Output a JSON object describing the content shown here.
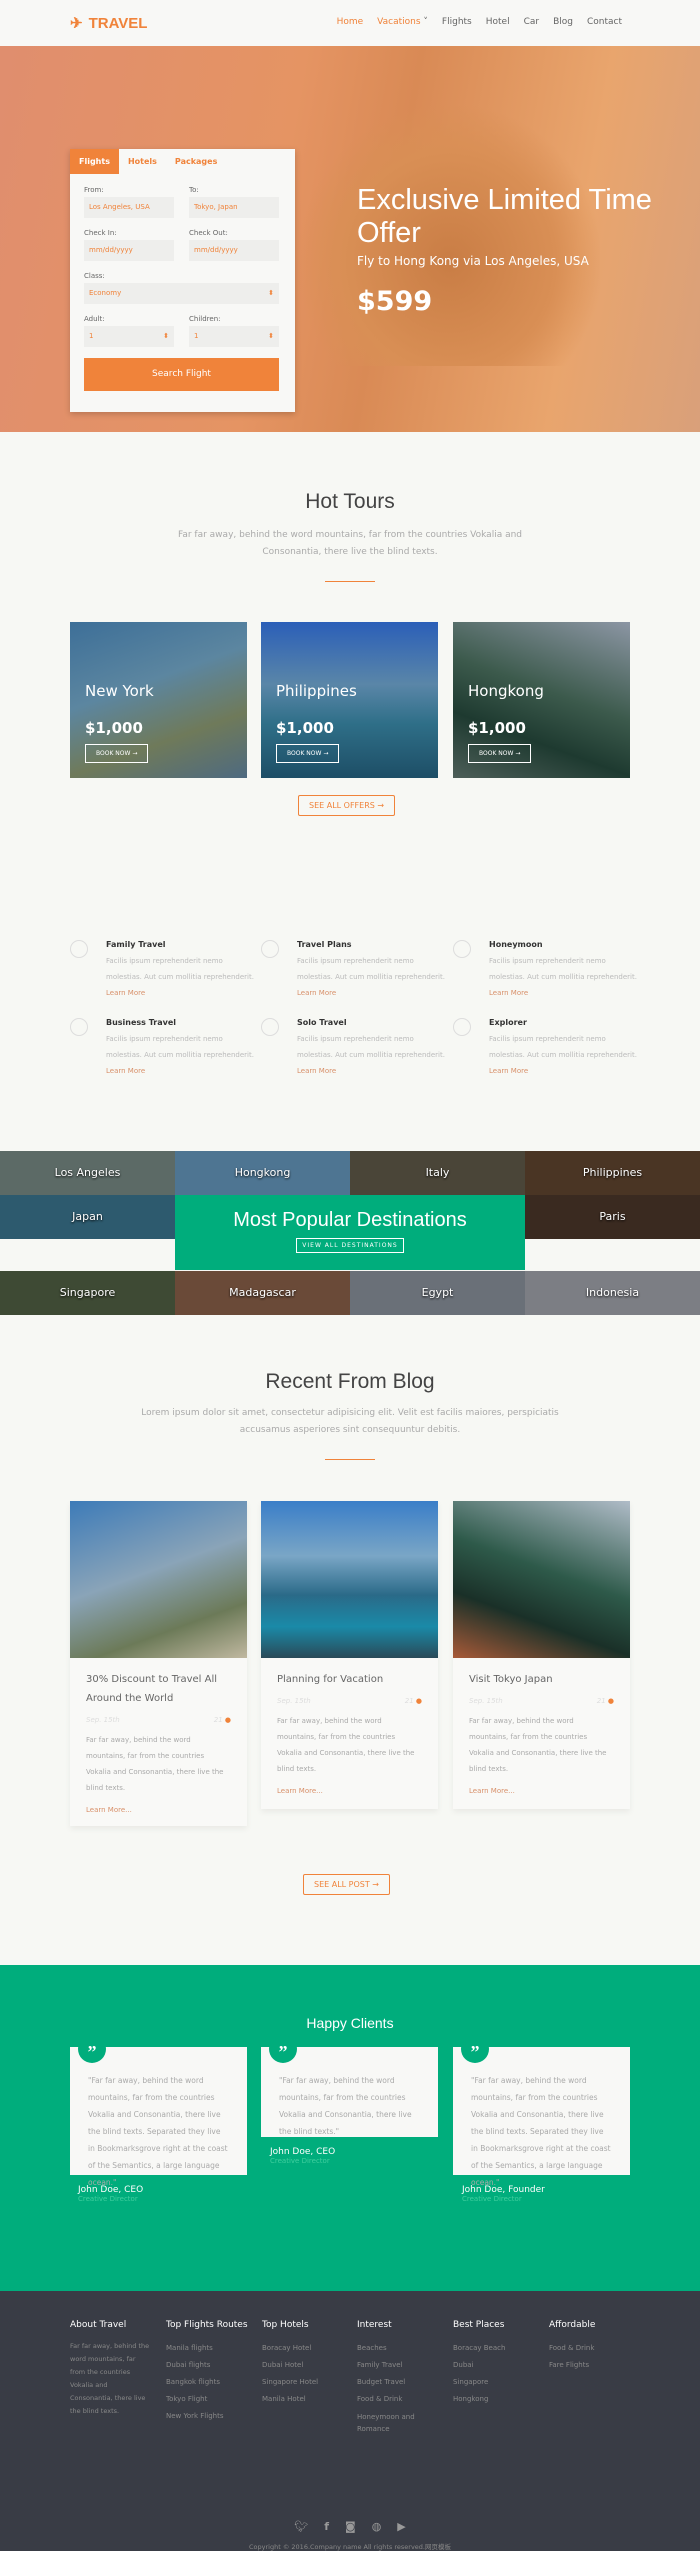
{
  "nav": {
    "logo": "TRAVEL",
    "items": [
      "Home",
      "Vacations",
      "Flights",
      "Hotel",
      "Car",
      "Blog",
      "Contact"
    ]
  },
  "search": {
    "tabs": [
      "Flights",
      "Hotels",
      "Packages"
    ],
    "from_label": "From:",
    "from_value": "Los Angeles, USA",
    "to_label": "To:",
    "to_value": "Tokyo, Japan",
    "checkin_label": "Check In:",
    "checkin_placeholder": "mm/dd/yyyy",
    "checkout_label": "Check Out:",
    "checkout_placeholder": "mm/dd/yyyy",
    "class_label": "Class:",
    "class_value": "Economy",
    "adult_label": "Adult:",
    "adult_value": "1",
    "children_label": "Children:",
    "children_value": "1",
    "button": "Search Flight"
  },
  "hero": {
    "title": "Exclusive Limited Time Offer",
    "subtitle": "Fly to Hong Kong via Los Angeles, USA",
    "price": "$599"
  },
  "hot_tours": {
    "title": "Hot Tours",
    "subtitle": "Far far away, behind the word mountains, far from the countries Vokalia and Consonantia, there live the blind texts.",
    "tours": [
      {
        "name": "New York",
        "price": "$1,000",
        "button": "BOOK NOW →"
      },
      {
        "name": "Philippines",
        "price": "$1,000",
        "button": "BOOK NOW →"
      },
      {
        "name": "Hongkong",
        "price": "$1,000",
        "button": "BOOK NOW →"
      }
    ],
    "see_all": "SEE ALL OFFERS →"
  },
  "features": [
    {
      "title": "Family Travel",
      "text": "Facilis ipsum reprehenderit nemo molestias. Aut cum mollitia reprehenderit.",
      "link": "Learn More"
    },
    {
      "title": "Travel Plans",
      "text": "Facilis ipsum reprehenderit nemo molestias. Aut cum mollitia reprehenderit.",
      "link": "Learn More"
    },
    {
      "title": "Honeymoon",
      "text": "Facilis ipsum reprehenderit nemo molestias. Aut cum mollitia reprehenderit.",
      "link": "Learn More"
    },
    {
      "title": "Business Travel",
      "text": "Facilis ipsum reprehenderit nemo molestias. Aut cum mollitia reprehenderit.",
      "link": "Learn More"
    },
    {
      "title": "Solo Travel",
      "text": "Facilis ipsum reprehenderit nemo molestias. Aut cum mollitia reprehenderit.",
      "link": "Learn More"
    },
    {
      "title": "Explorer",
      "text": "Facilis ipsum reprehenderit nemo molestias. Aut cum mollitia reprehenderit.",
      "link": "Learn More"
    }
  ],
  "destinations": {
    "title": "Most Popular Destinations",
    "button": "VIEW ALL DESTINATIONS",
    "places": [
      "Los Angeles",
      "Hongkong",
      "Italy",
      "Philippines",
      "Japan",
      "Paris",
      "Singapore",
      "Madagascar",
      "Egypt",
      "Indonesia"
    ]
  },
  "blog": {
    "title": "Recent From Blog",
    "subtitle": "Lorem ipsum dolor sit amet, consectetur adipisicing elit. Velit est facilis maiores, perspiciatis accusamus asperiores sint consequuntur debitis.",
    "posts": [
      {
        "title": "30% Discount to Travel All Around the World",
        "date": "Sep. 15th",
        "comments": "21",
        "text": "Far far away, behind the word mountains, far from the countries Vokalia and Consonantia, there live the blind texts.",
        "link": "Learn More..."
      },
      {
        "title": "Planning for Vacation",
        "date": "Sep. 15th",
        "comments": "21",
        "text": "Far far away, behind the word mountains, far from the countries Vokalia and Consonantia, there live the blind texts.",
        "link": "Learn More..."
      },
      {
        "title": "Visit Tokyo Japan",
        "date": "Sep. 15th",
        "comments": "21",
        "text": "Far far away, behind the word mountains, far from the countries Vokalia and Consonantia, there live the blind texts.",
        "link": "Learn More..."
      }
    ],
    "see_all": "SEE ALL POST →"
  },
  "clients": {
    "title": "Happy Clients",
    "items": [
      {
        "quote": "\"Far far away, behind the word mountains, far from the countries Vokalia and Consonantia, there live the blind texts. Separated they live in Bookmarksgrove right at the coast of the Semantics, a large language ocean.\"",
        "name": "John Doe, CEO",
        "role": "Creative Director"
      },
      {
        "quote": "\"Far far away, behind the word mountains, far from the countries Vokalia and Consonantia, there live the blind texts.\"",
        "name": "John Doe, CEO",
        "role": "Creative Director"
      },
      {
        "quote": "\"Far far away, behind the word mountains, far from the countries Vokalia and Consonantia, there live the blind texts. Separated they live in Bookmarksgrove right at the coast of the Semantics, a large language ocean.\"",
        "name": "John Doe, Founder",
        "role": "Creative Director"
      }
    ]
  },
  "footer": {
    "about_title": "About Travel",
    "about_text": "Far far away, behind the word mountains, far from the countries Vokalia and Consonantia, there live the blind texts.",
    "columns": [
      {
        "title": "Top Flights Routes",
        "links": [
          "Manila flights",
          "Dubai flights",
          "Bangkok flights",
          "Tokyo Flight",
          "New York Flights"
        ]
      },
      {
        "title": "Top Hotels",
        "links": [
          "Boracay Hotel",
          "Dubai Hotel",
          "Singapore Hotel",
          "Manila Hotel"
        ]
      },
      {
        "title": "Interest",
        "links": [
          "Beaches",
          "Family Travel",
          "Budget Travel",
          "Food & Drink",
          "Honeymoon and Romance"
        ]
      },
      {
        "title": "Best Places",
        "links": [
          "Boracay Beach",
          "Dubai",
          "Singapore",
          "Hongkong"
        ]
      },
      {
        "title": "Affordable",
        "links": [
          "Food & Drink",
          "Fare Flights"
        ]
      }
    ],
    "social": [
      "twitter-icon",
      "facebook-icon",
      "instagram-icon",
      "dribbble-icon",
      "youtube-icon"
    ],
    "copyright": "Copyright © 2016.Company name All rights reserved.网页模板"
  },
  "colors": {
    "accent": "#f0833a",
    "green": "#00ad7c",
    "footer": "#393c45"
  }
}
